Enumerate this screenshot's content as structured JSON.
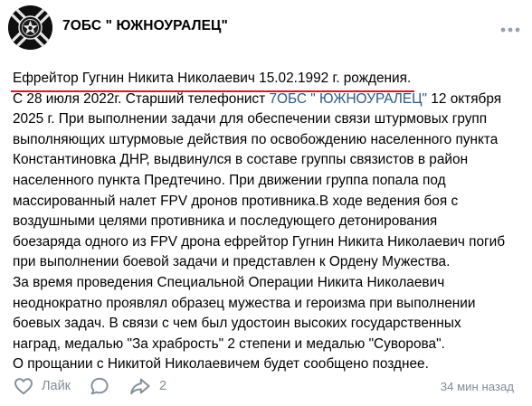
{
  "post": {
    "author": {
      "name": "7ОБС \" ЮЖНОУРАЛЕЦ\"",
      "avatar_icon": "military-emblem-icon"
    },
    "more_icon": "more-horizontal-icon",
    "headline": "Ефрейтор Гугнин Никита Николаевич 15.02.1992 г. рождения.",
    "highlight_color": "#e0142a",
    "link_color": "#2a5885",
    "text": {
      "l2a": "С 28 июля 2022г. Старший телефонист ",
      "l2_link": "7ОБС \" ЮЖНОУРАЛЕЦ\"",
      "l2b": " 12 октября",
      "l3": "2025 г. При выполнении задачи для обеспечении связи штурмовых групп",
      "l4": "выполняющих штурмовые действия по освобождению населенного пункта",
      "l5": "Константиновка ДНР, выдвинулся в составе группы связистов в район",
      "l6": "населенного пункта Предтечино. При движении группа попала под",
      "l7": "массированный налет FPV дронов противника.В ходе ведения боя с",
      "l8": "воздушными целями противника и последующего детонирования",
      "l9": "боезаряда одного из FPV дрона ефрейтор Гугнин Никита Николаевич погиб",
      "l10": "при выполнении боевой задачи и представлен к Ордену Мужества.",
      "l11": "За время проведения Специальной Операции Никита Николаевич",
      "l12": "неоднократно проявлял образец мужества и героизма при выполнении",
      "l13": "боевых задач. В связи с чем был удостоин высоких государственных",
      "l14": "наград, медалью \"За храбрость\" 2 степени и медалью \"Суворова\".",
      "l15": "О прощании с Никитой Николаевичем будет сообщено позднее."
    },
    "footer": {
      "like_label": "Лайк",
      "like_icon": "heart-icon",
      "comment_icon": "comment-icon",
      "share_icon": "share-icon",
      "share_count": "2",
      "timestamp": "34 мин назад",
      "icon_color": "#818c99"
    }
  }
}
